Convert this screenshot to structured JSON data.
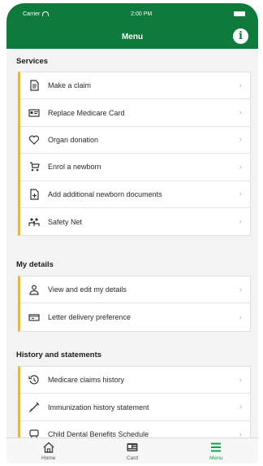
{
  "status_bar": {
    "carrier": "Carrier",
    "time": "2:00 PM"
  },
  "header": {
    "title": "Menu",
    "info_glyph": "i"
  },
  "sections": [
    {
      "title": "Services",
      "items": [
        {
          "label": "Make a claim",
          "icon": "document-icon"
        },
        {
          "label": "Replace Medicare Card",
          "icon": "card-icon"
        },
        {
          "label": "Organ donation",
          "icon": "heart-icon"
        },
        {
          "label": "Enrol a newborn",
          "icon": "stroller-icon"
        },
        {
          "label": "Add additional newborn documents",
          "icon": "document-plus-icon"
        },
        {
          "label": "Safety Net",
          "icon": "family-icon"
        }
      ]
    },
    {
      "title": "My details",
      "items": [
        {
          "label": "View and edit my details",
          "icon": "person-icon"
        },
        {
          "label": "Letter delivery preference",
          "icon": "mailbox-icon"
        }
      ]
    },
    {
      "title": "History and statements",
      "items": [
        {
          "label": "Medicare claims history",
          "icon": "history-icon"
        },
        {
          "label": "Immunization history statement",
          "icon": "syringe-icon"
        },
        {
          "label": "Child Dental Benefits Schedule",
          "icon": "tooth-icon"
        }
      ]
    }
  ],
  "chevron": "›",
  "tabs": [
    {
      "label": "Home",
      "icon": "home-icon",
      "active": false
    },
    {
      "label": "Card",
      "icon": "card-icon",
      "active": false
    },
    {
      "label": "Menu",
      "icon": "menu-icon",
      "active": true
    }
  ],
  "colors": {
    "primary": "#0e7a3b",
    "accent_bar": "#e2b54a",
    "active_tab": "#14a14a"
  }
}
